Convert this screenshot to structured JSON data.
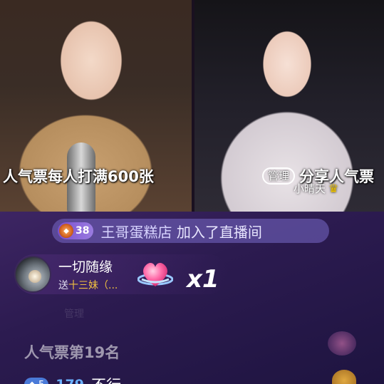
{
  "stream": {
    "left_caption": "人气票每人打满600张",
    "right_admin_badge": "管理",
    "right_caption": "分享人气票",
    "right_host_name": "小晴天"
  },
  "join_notice": {
    "level": "38",
    "username": "王哥蛋糕店",
    "action": "加入了直播间"
  },
  "gift": {
    "sender": "一切随缘",
    "send_prefix": "送",
    "target": "十三妹（...",
    "combo": "x1"
  },
  "chat": {
    "faded_label": "管理",
    "rank_text": "人气票第19名",
    "bottom_badge": "5",
    "bottom_number": "179",
    "bottom_message": "不行"
  },
  "colors": {
    "chat_bg": "#2c1b50",
    "join_pill": "#7869c8",
    "gift_target": "#f0c040",
    "crown": "#f0c400"
  }
}
